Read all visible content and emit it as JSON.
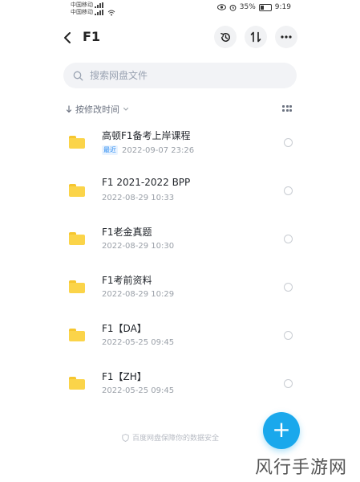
{
  "status_bar": {
    "carrier_1": "中国移动",
    "carrier_2": "中国移动",
    "battery": "35%",
    "time": "9:19"
  },
  "header": {
    "title": "F1",
    "back_icon": "chevron-left-icon",
    "history_icon": "history-icon",
    "sort_icon": "sort-icon",
    "more_icon": "more-icon"
  },
  "search": {
    "placeholder": "搜索网盘文件"
  },
  "sort": {
    "label": "按修改时间"
  },
  "files": [
    {
      "name": "高顿F1备考上岸课程",
      "badge": "最近",
      "date": "2022-09-07  23:26"
    },
    {
      "name": "F1 2021-2022 BPP",
      "badge": "",
      "date": "2022-08-29  10:33"
    },
    {
      "name": "F1老金真题",
      "badge": "",
      "date": "2022-08-29  10:30"
    },
    {
      "name": "F1考前资料",
      "badge": "",
      "date": "2022-08-29  10:29"
    },
    {
      "name": "F1【DA】",
      "badge": "",
      "date": "2022-05-25  09:45"
    },
    {
      "name": "F1【ZH】",
      "badge": "",
      "date": "2022-05-25  09:45"
    }
  ],
  "footer": {
    "note": "百度网盘保障你的数据安全"
  },
  "fab": {
    "label": "+"
  },
  "watermark": "风行手游网",
  "colors": {
    "accent": "#1aa8ec",
    "folder": "#fbd449",
    "recent_badge": "#2d8cf0"
  }
}
